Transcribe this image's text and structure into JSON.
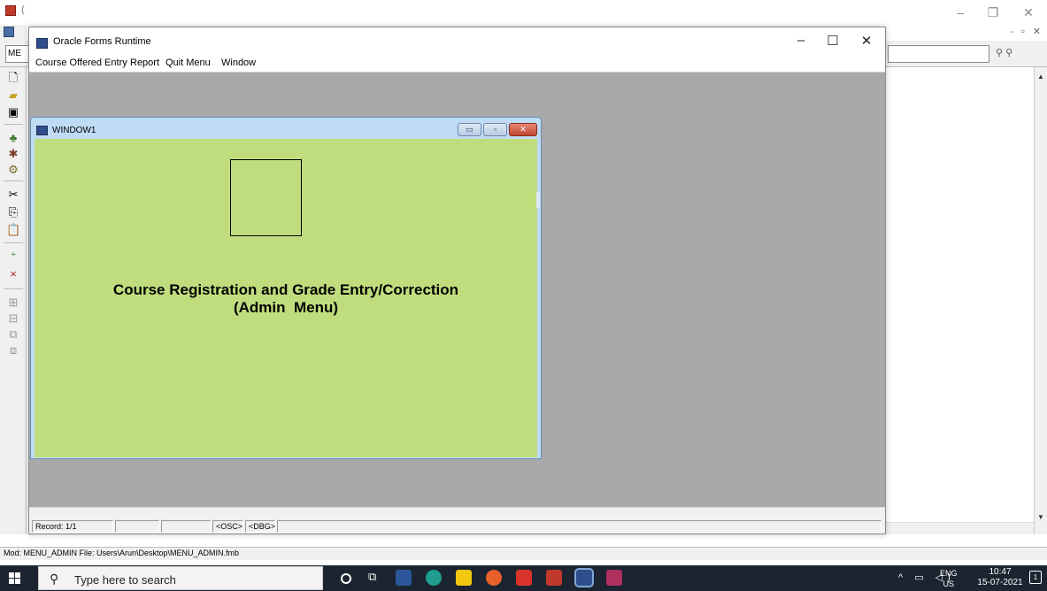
{
  "back_window": {
    "title_fragment": "(",
    "module_field": "ME",
    "status_text": "Mod: MENU_ADMIN File: Users\\Arun\\Desktop\\MENU_ADMIN.fmb"
  },
  "runtime_window": {
    "title": "Oracle Forms Runtime",
    "menu": [
      "Course Offered Entry",
      "Report",
      "Quit Menu",
      "Window"
    ]
  },
  "window1": {
    "title": "WINDOW1",
    "heading_line1": "Course Registration and Grade Entry/Correction",
    "heading_line2": "(Admin  Menu)"
  },
  "status_bar": {
    "record": "Record: 1/1",
    "osc": "<OSC>",
    "dbg": "<DBG>"
  },
  "taskbar": {
    "search_placeholder": "Type here to search",
    "lang_primary": "ENG",
    "lang_secondary": "US",
    "time": "10:47",
    "date": "15-07-2021"
  },
  "colors": {
    "canvas_bg": "#c0dd7e",
    "mdi_bg": "#a9a9a9",
    "taskbar_bg": "#1b2430"
  }
}
